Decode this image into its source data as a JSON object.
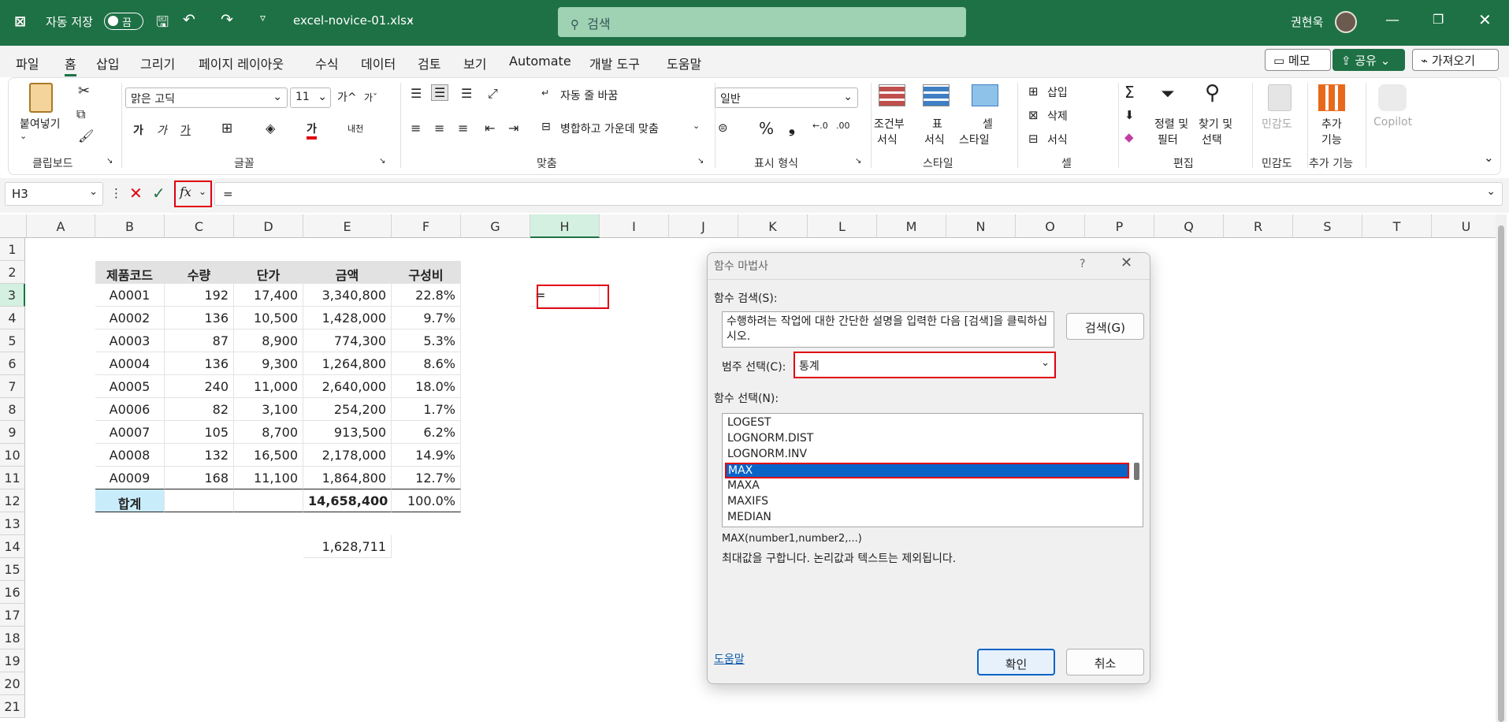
{
  "titlebar": {
    "autosave_label": "자동 저장",
    "autosave_state": "끔",
    "filename": "excel-novice-01.xlsx",
    "search_placeholder": "검색",
    "user_name": "권현욱"
  },
  "menu": {
    "tabs": [
      "파일",
      "홈",
      "삽입",
      "그리기",
      "페이지 레이아웃",
      "수식",
      "데이터",
      "검토",
      "보기",
      "Automate",
      "개발 도구",
      "도움말"
    ],
    "active_tab": "홈",
    "memo_label": "메모",
    "share_label": "공유",
    "import_label": "가져오기"
  },
  "ribbon": {
    "paste_label": "붙여넣기",
    "font_name": "맑은 고딕",
    "font_size": "11",
    "wrap_text": "자동 줄 바꿈",
    "merge_center": "병합하고 가운데 맞춤",
    "number_format": "일반",
    "cond_format_1": "조건부",
    "cond_format_2": "서식",
    "table_1": "표",
    "table_2": "서식",
    "cell_style_1": "셀",
    "cell_style_2": "스타일",
    "insert": "삽입",
    "delete": "삭제",
    "format": "서식",
    "sort_1": "정렬 및",
    "sort_2": "필터",
    "find_1": "찾기 및",
    "find_2": "선택",
    "sensitivity": "민감도",
    "addins_1": "추가",
    "addins_2": "기능",
    "copilot": "Copilot",
    "groups": {
      "clipboard": "클립보드",
      "font": "글꼴",
      "align": "맞춤",
      "number": "표시 형식",
      "style": "스타일",
      "cells": "셀",
      "edit": "편집",
      "sensitivity": "민감도",
      "addins": "추가 기능"
    }
  },
  "formula_bar": {
    "name_box": "H3",
    "formula": "="
  },
  "sheet": {
    "columns": [
      "A",
      "B",
      "C",
      "D",
      "E",
      "F",
      "G",
      "H",
      "I",
      "J",
      "K",
      "L",
      "M",
      "N",
      "O",
      "P",
      "Q",
      "R",
      "S",
      "T",
      "U"
    ],
    "rows": [
      "1",
      "2",
      "3",
      "4",
      "5",
      "6",
      "7",
      "8",
      "9",
      "10",
      "11",
      "12",
      "13",
      "14",
      "15",
      "16",
      "17",
      "18",
      "19",
      "20",
      "21"
    ],
    "header": [
      "제품코드",
      "수량",
      "단가",
      "금액",
      "구성비"
    ],
    "data": [
      [
        "A0001",
        "192",
        "17,400",
        "3,340,800",
        "22.8%"
      ],
      [
        "A0002",
        "136",
        "10,500",
        "1,428,000",
        "9.7%"
      ],
      [
        "A0003",
        "87",
        "8,900",
        "774,300",
        "5.3%"
      ],
      [
        "A0004",
        "136",
        "9,300",
        "1,264,800",
        "8.6%"
      ],
      [
        "A0005",
        "240",
        "11,000",
        "2,640,000",
        "18.0%"
      ],
      [
        "A0006",
        "82",
        "3,100",
        "254,200",
        "1.7%"
      ],
      [
        "A0007",
        "105",
        "8,700",
        "913,500",
        "6.2%"
      ],
      [
        "A0008",
        "132",
        "16,500",
        "2,178,000",
        "14.9%"
      ],
      [
        "A0009",
        "168",
        "11,100",
        "1,864,800",
        "12.7%"
      ]
    ],
    "total_label": "합계",
    "total_amount": "14,658,400",
    "total_ratio": "100.0%",
    "e14": "1,628,711",
    "h3": "="
  },
  "dialog": {
    "title": "함수 마법사",
    "help_glyph": "?",
    "search_label": "함수 검색(S):",
    "search_text": "수행하려는 작업에 대한 간단한 설명을 입력한 다음 [검색]을 클릭하십시오.",
    "search_button": "검색(G)",
    "category_label": "범주 선택(C):",
    "category_value": "통계",
    "function_label": "함수 선택(N):",
    "functions": [
      "LOGEST",
      "LOGNORM.DIST",
      "LOGNORM.INV",
      "MAX",
      "MAXA",
      "MAXIFS",
      "MEDIAN"
    ],
    "selected_function": "MAX",
    "syntax": "MAX(number1,number2,...)",
    "description": "최대값을 구합니다. 논리값과 텍스트는 제외됩니다.",
    "help_link": "도움말",
    "ok": "확인",
    "cancel": "취소"
  },
  "colors": {
    "excel_green": "#1e7145",
    "highlight_red": "#e1000f",
    "selection_blue": "#0a64c8",
    "total_fill": "#c9ecfa"
  }
}
